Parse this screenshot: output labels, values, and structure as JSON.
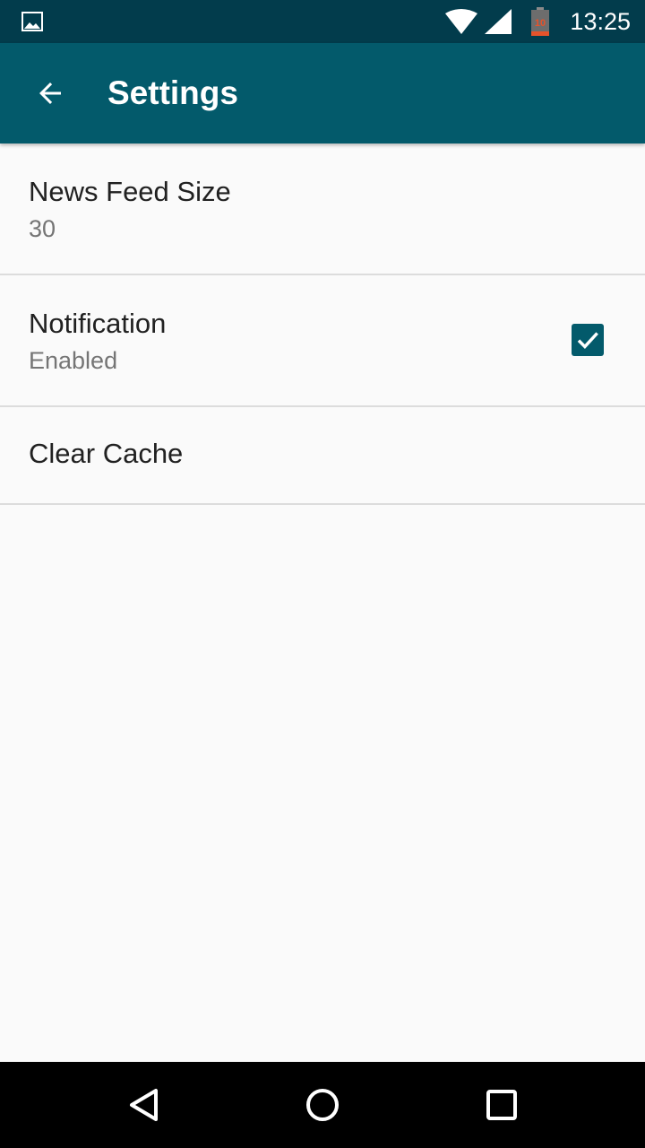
{
  "status_bar": {
    "time": "13:25",
    "battery_level": "10",
    "icons": [
      "image-notification-icon",
      "wifi-icon",
      "cell-signal-icon",
      "battery-icon"
    ]
  },
  "app_bar": {
    "title": "Settings",
    "back_icon": "arrow-back-icon"
  },
  "preferences": [
    {
      "title": "News Feed Size",
      "summary": "30"
    },
    {
      "title": "Notification",
      "summary": "Enabled",
      "checked": true
    },
    {
      "title": "Clear Cache"
    }
  ],
  "nav_bar": {
    "icons": [
      "back-triangle-icon",
      "home-circle-icon",
      "recents-square-icon"
    ]
  },
  "colors": {
    "status_bar": "#023c4c",
    "app_bar": "#035a6b",
    "accent": "#035a6b",
    "background": "#fafafa",
    "divider": "#dcdcdc",
    "battery_low": "#e5532b"
  }
}
